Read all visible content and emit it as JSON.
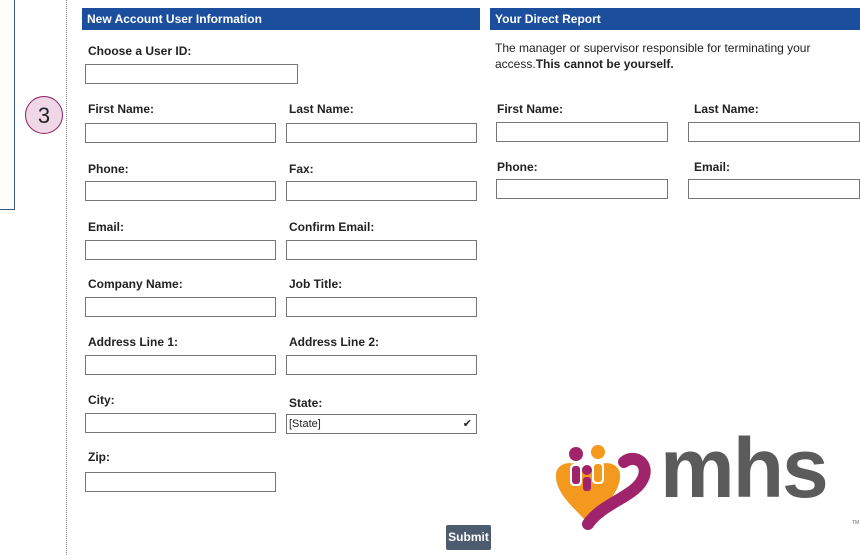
{
  "step_badge": "3",
  "left_panel": {
    "header": "New Account User Information",
    "user_id_label": "Choose a User ID:",
    "first_name_label": "First Name:",
    "last_name_label": "Last Name:",
    "phone_label": "Phone:",
    "fax_label": "Fax:",
    "email_label": "Email:",
    "confirm_email_label": "Confirm Email:",
    "company_label": "Company Name:",
    "job_title_label": "Job Title:",
    "address1_label": "Address Line 1:",
    "address2_label": "Address Line 2:",
    "city_label": "City:",
    "state_label": "State:",
    "state_value": "[State]",
    "zip_label": "Zip:"
  },
  "right_panel": {
    "header": "Your Direct Report",
    "note_line1": "The manager or supervisor responsible for terminating your access.",
    "note_bold": "This cannot be yourself.",
    "first_name_label": "First Name:",
    "last_name_label": "Last Name:",
    "phone_label": "Phone:",
    "email_label": "Email:"
  },
  "submit_label": "Submit",
  "logo": {
    "text": "mhs",
    "tm": "TM",
    "colors": {
      "orange": "#f39a1e",
      "magenta": "#a0246b",
      "gray": "#5b5b5b"
    }
  },
  "colors": {
    "header_bg": "#1b4f9e",
    "submit_bg": "#4d5b6f",
    "badge_bg": "#efd7e8",
    "badge_border": "#8b1e5e"
  }
}
